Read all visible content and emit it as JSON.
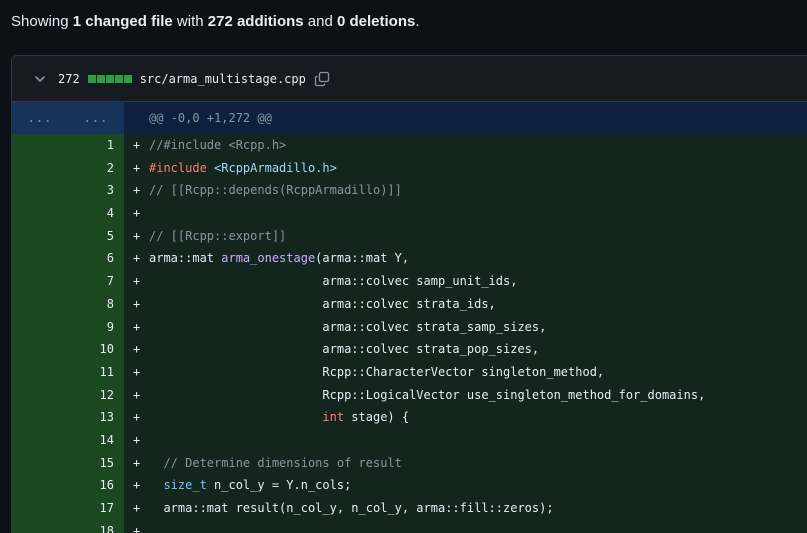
{
  "summary": {
    "prefix": "Showing ",
    "files": "1 changed file",
    "mid1": " with ",
    "additions": "272 additions",
    "mid2": " and ",
    "deletions": "0 deletions",
    "suffix": "."
  },
  "file": {
    "count": "272",
    "path": "src/arma_multistage.cpp",
    "diffstat_color": "#2ea043"
  },
  "hunk": {
    "left_dots": "...",
    "right_dots": "...",
    "header": "@@ -0,0 +1,272 @@"
  },
  "lines": [
    {
      "num": "1",
      "sign": "+",
      "segments": [
        {
          "t": "//#include <Rcpp.h>",
          "k": "comment"
        }
      ]
    },
    {
      "num": "2",
      "sign": "+",
      "segments": [
        {
          "t": "#include",
          "k": "kw"
        },
        {
          "t": " ",
          "k": ""
        },
        {
          "t": "<RcppArmadillo.h>",
          "k": "str"
        }
      ]
    },
    {
      "num": "3",
      "sign": "+",
      "segments": [
        {
          "t": "// [[Rcpp::depends(RcppArmadillo)]]",
          "k": "comment"
        }
      ]
    },
    {
      "num": "4",
      "sign": "+",
      "segments": []
    },
    {
      "num": "5",
      "sign": "+",
      "segments": [
        {
          "t": "// [[Rcpp::export]]",
          "k": "comment"
        }
      ]
    },
    {
      "num": "6",
      "sign": "+",
      "segments": [
        {
          "t": "arma::mat ",
          "k": ""
        },
        {
          "t": "arma_onestage",
          "k": "fn"
        },
        {
          "t": "(arma::mat Y,",
          "k": ""
        }
      ]
    },
    {
      "num": "7",
      "sign": "+",
      "segments": [
        {
          "t": "                        arma::colvec samp_unit_ids,",
          "k": ""
        }
      ]
    },
    {
      "num": "8",
      "sign": "+",
      "segments": [
        {
          "t": "                        arma::colvec strata_ids,",
          "k": ""
        }
      ]
    },
    {
      "num": "9",
      "sign": "+",
      "segments": [
        {
          "t": "                        arma::colvec strata_samp_sizes,",
          "k": ""
        }
      ]
    },
    {
      "num": "10",
      "sign": "+",
      "segments": [
        {
          "t": "                        arma::colvec strata_pop_sizes,",
          "k": ""
        }
      ]
    },
    {
      "num": "11",
      "sign": "+",
      "segments": [
        {
          "t": "                        Rcpp::CharacterVector singleton_method,",
          "k": ""
        }
      ]
    },
    {
      "num": "12",
      "sign": "+",
      "segments": [
        {
          "t": "                        Rcpp::LogicalVector use_singleton_method_for_domains,",
          "k": ""
        }
      ]
    },
    {
      "num": "13",
      "sign": "+",
      "segments": [
        {
          "t": "                        ",
          "k": ""
        },
        {
          "t": "int",
          "k": "kw"
        },
        {
          "t": " stage) {",
          "k": ""
        }
      ]
    },
    {
      "num": "14",
      "sign": "+",
      "segments": []
    },
    {
      "num": "15",
      "sign": "+",
      "segments": [
        {
          "t": "  // Determine dimensions of result",
          "k": "comment"
        }
      ]
    },
    {
      "num": "16",
      "sign": "+",
      "segments": [
        {
          "t": "  ",
          "k": ""
        },
        {
          "t": "size_t",
          "k": "type"
        },
        {
          "t": " n_col_y = Y.n_cols;",
          "k": ""
        }
      ]
    },
    {
      "num": "17",
      "sign": "+",
      "segments": [
        {
          "t": "  arma::mat result(n_col_y, n_col_y, arma::fill::zeros);",
          "k": ""
        }
      ]
    },
    {
      "num": "18",
      "sign": "+",
      "segments": []
    }
  ]
}
